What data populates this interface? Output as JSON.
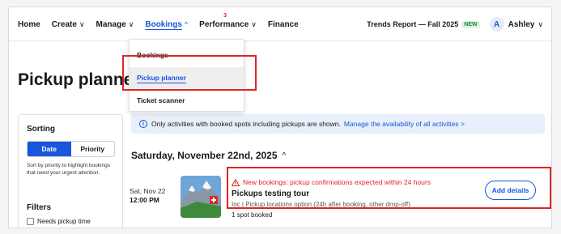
{
  "nav": {
    "items": [
      {
        "label": "Home",
        "has_chevron": false
      },
      {
        "label": "Create",
        "has_chevron": true
      },
      {
        "label": "Manage",
        "has_chevron": true
      },
      {
        "label": "Bookings",
        "has_chevron": true,
        "chevron": "^"
      },
      {
        "label": "Performance",
        "has_chevron": true,
        "badge": "3"
      },
      {
        "label": "Finance",
        "has_chevron": false
      }
    ],
    "chev_down": "∨",
    "chev_up": "^"
  },
  "topright": {
    "report": "Trends Report — Fall 2025",
    "new_badge": "NEW",
    "avatar_letter": "A",
    "user": "Ashley",
    "chev": "∨"
  },
  "page": {
    "title": "Pickup planner"
  },
  "dropdown": {
    "items": [
      "Bookings",
      "Pickup planner",
      "Ticket scanner"
    ],
    "selected": "Pickup planner"
  },
  "sidebar": {
    "sorting_title": "Sorting",
    "sort_options": [
      "Date",
      "Priority"
    ],
    "sort_selected": "Date",
    "sort_help": "Sort by priority to highlight bookings that need your urgent attention.",
    "filters_title": "Filters",
    "filter_label": "Needs pickup time"
  },
  "info": {
    "icon": "info-icon",
    "text": "Only activities with booked spots including pickups are shown.",
    "link": "Manage the availability of all activities >"
  },
  "schedule": {
    "date_heading": "Saturday, November 22nd, 2025",
    "chev": "^",
    "row": {
      "date": "Sat, Nov 22",
      "time": "12:00 PM",
      "alert": "New bookings: pickup confirmations expected within 24 hours",
      "title": "Pickups testing tour",
      "subtitle": "Ioc | Pickup locations option (24h after booking, other drop-off)",
      "booked": "1 spot booked",
      "button": "Add details"
    }
  },
  "colors": {
    "accent": "#1a56db",
    "alert": "#e02424",
    "info_bg": "#e7f0fb"
  }
}
